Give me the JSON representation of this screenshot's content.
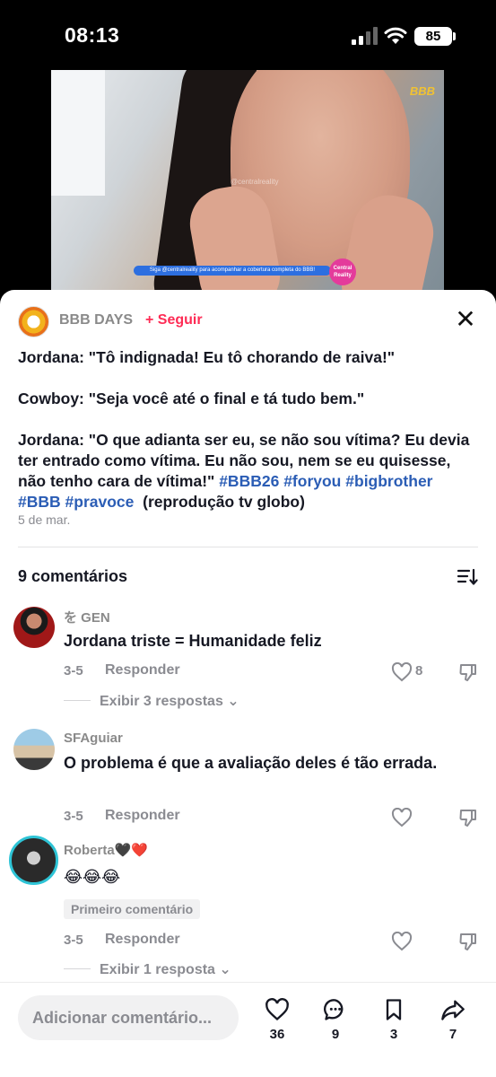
{
  "status_bar": {
    "time": "08:13",
    "battery": "85"
  },
  "video": {
    "logo": "BBB",
    "watermark": "@centralreality",
    "banner": "Siga @centralreality para acompanhar a cobertura completa do BBB!",
    "badge": "Central Reality"
  },
  "post": {
    "author": "BBB DAYS",
    "follow_label": "+ Seguir",
    "caption_lines": [
      "Jordana: \"Tô indignada! Eu tô chorando de raiva!\"",
      "Cowboy: \"Seja você até o final e tá tudo bem.\"",
      "Jordana: \"O que adianta ser eu, se não sou vítima? Eu devia ter entrado como vítima. Eu não sou, nem se eu quisesse, não tenho cara de vítima!\""
    ],
    "hashtags": [
      "#BBB26",
      "#foryou",
      "#bigbrother",
      "#BBB",
      "#pravoce"
    ],
    "caption_suffix": "(reprodução tv globo)",
    "date": "5 de mar."
  },
  "comments_header": {
    "count_label": "9 comentários"
  },
  "comments": [
    {
      "user": "を GEN",
      "text": "Jordana triste = Humanidade feliz",
      "date": "3-5",
      "reply_label": "Responder",
      "likes": "8",
      "view_replies": "Exibir 3 respostas"
    },
    {
      "user": "SFAguiar",
      "text": "O problema é que a avaliação deles é tão errada.",
      "date": "3-5",
      "reply_label": "Responder"
    },
    {
      "user": "Roberta🖤❤️",
      "text": "😂😂😂",
      "badge": "Primeiro comentário",
      "date": "3-5",
      "reply_label": "Responder",
      "view_replies": "Exibir 1 resposta"
    }
  ],
  "bottom_bar": {
    "placeholder": "Adicionar comentário...",
    "likes": "36",
    "comments": "9",
    "saves": "3",
    "shares": "7"
  },
  "colors": {
    "accent": "#fe2c55",
    "hashtag": "#2b5db5",
    "muted": "#8a8b91"
  }
}
